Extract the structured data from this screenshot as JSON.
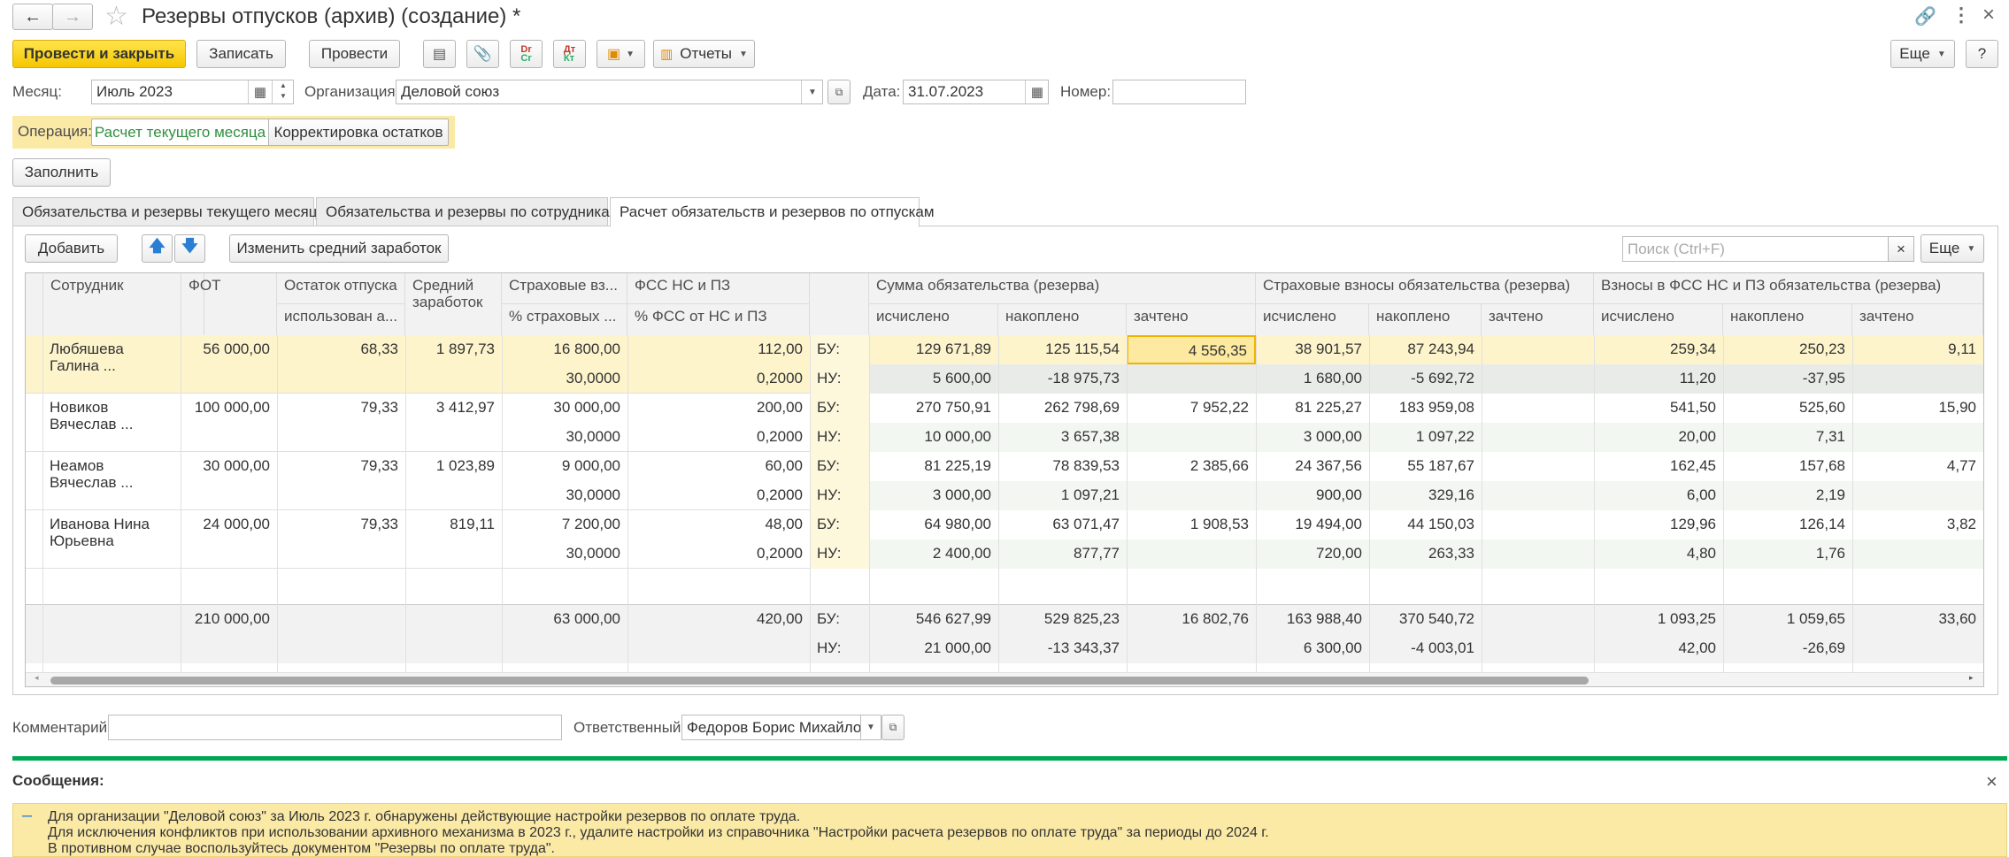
{
  "window": {
    "title": "Резервы отпусков (архив) (создание) *"
  },
  "toolbar": {
    "post_close": "Провести и закрыть",
    "save": "Записать",
    "post": "Провести",
    "reports": "Отчеты",
    "more": "Еще",
    "help": "?"
  },
  "header": {
    "month_label": "Месяц:",
    "month_value": "Июль 2023",
    "org_label": "Организация:",
    "org_value": "Деловой союз",
    "date_label": "Дата:",
    "date_value": "31.07.2023",
    "number_label": "Номер:",
    "number_value": ""
  },
  "operation": {
    "label": "Операция:",
    "options": [
      "Расчет текущего месяца",
      "Корректировка остатков"
    ],
    "selected": "Расчет текущего месяца"
  },
  "fill_button": "Заполнить",
  "tabs": [
    {
      "label": "Обязательства и резервы текущего месяца",
      "active": false
    },
    {
      "label": "Обязательства и резервы по сотрудникам",
      "active": false
    },
    {
      "label": "Расчет обязательств и резервов по отпускам",
      "active": true
    }
  ],
  "grid_toolbar": {
    "add": "Добавить",
    "change_avg": "Изменить средний заработок",
    "search_placeholder": "Поиск (Ctrl+F)",
    "clear": "×",
    "more": "Еще"
  },
  "columns": {
    "employee": "Сотрудник",
    "fot": "ФОТ",
    "vacation_balance": "Остаток отпуска",
    "vacation_used": "использован а...",
    "avg_earnings": "Средний заработок",
    "insurance": "Страховые вз...",
    "insurance_pct": "% страховых ...",
    "fss": "ФСС НС и ПЗ",
    "fss_pct": "% ФСС от НС и ПЗ",
    "group_sum": "Сумма обязательства (резерва)",
    "group_ins": "Страховые взносы обязательства (резерва)",
    "group_fss": "Взносы в ФСС НС и ПЗ обязательства (резерва)",
    "calculated": "исчислено",
    "accrued": "накоплено",
    "credited": "зачтено"
  },
  "rows": [
    {
      "employee": "Любяшева Галина ...",
      "fot": "56 000,00",
      "balance": "68,33",
      "avg": "1 897,73",
      "ins": "16 800,00",
      "ins_pct": "30,0000",
      "fss": "112,00",
      "fss_pct": "0,2000",
      "bu": [
        "129 671,89",
        "125 115,54",
        "4 556,35",
        "38 901,57",
        "87 243,94",
        "",
        "259,34",
        "250,23",
        "9,11"
      ],
      "nu": [
        "5 600,00",
        "-18 975,73",
        "",
        "1 680,00",
        "-5 692,72",
        "",
        "11,20",
        "-37,95",
        ""
      ]
    },
    {
      "employee": "Новиков Вячеслав ...",
      "fot": "100 000,00",
      "balance": "79,33",
      "avg": "3 412,97",
      "ins": "30 000,00",
      "ins_pct": "30,0000",
      "fss": "200,00",
      "fss_pct": "0,2000",
      "bu": [
        "270 750,91",
        "262 798,69",
        "7 952,22",
        "81 225,27",
        "183 959,08",
        "",
        "541,50",
        "525,60",
        "15,90"
      ],
      "nu": [
        "10 000,00",
        "3 657,38",
        "",
        "3 000,00",
        "1 097,22",
        "",
        "20,00",
        "7,31",
        ""
      ]
    },
    {
      "employee": "Неамов Вячеслав ...",
      "fot": "30 000,00",
      "balance": "79,33",
      "avg": "1 023,89",
      "ins": "9 000,00",
      "ins_pct": "30,0000",
      "fss": "60,00",
      "fss_pct": "0,2000",
      "bu": [
        "81 225,19",
        "78 839,53",
        "2 385,66",
        "24 367,56",
        "55 187,67",
        "",
        "162,45",
        "157,68",
        "4,77"
      ],
      "nu": [
        "3 000,00",
        "1 097,21",
        "",
        "900,00",
        "329,16",
        "",
        "6,00",
        "2,19",
        ""
      ]
    },
    {
      "employee": "Иванова Нина Юрьевна",
      "fot": "24 000,00",
      "balance": "79,33",
      "avg": "819,11",
      "ins": "7 200,00",
      "ins_pct": "30,0000",
      "fss": "48,00",
      "fss_pct": "0,2000",
      "bu": [
        "64 980,00",
        "63 071,47",
        "1 908,53",
        "19 494,00",
        "44 150,03",
        "",
        "129,96",
        "126,14",
        "3,82"
      ],
      "nu": [
        "2 400,00",
        "877,77",
        "",
        "720,00",
        "263,33",
        "",
        "4,80",
        "1,76",
        ""
      ]
    }
  ],
  "row_labels": {
    "bu": "БУ:",
    "nu": "НУ:"
  },
  "totals": {
    "fot": "210 000,00",
    "ins": "63 000,00",
    "fss": "420,00",
    "bu": [
      "546 627,99",
      "529 825,23",
      "16 802,76",
      "163 988,40",
      "370 540,72",
      "",
      "1 093,25",
      "1 059,65",
      "33,60"
    ],
    "nu": [
      "21 000,00",
      "-13 343,37",
      "",
      "6 300,00",
      "-4 003,01",
      "",
      "42,00",
      "-26,69",
      ""
    ]
  },
  "footer": {
    "comment_label": "Комментарий:",
    "comment_value": "",
    "responsible_label": "Ответственный:",
    "responsible_value": "Федоров Борис Михайлови"
  },
  "messages": {
    "title": "Сообщения:",
    "close": "×",
    "lines": [
      "Для организации \"Деловой союз\" за Июль 2023 г. обнаружены действующие настройки резервов по оплате труда.",
      "Для исключения конфликтов при использовании архивного механизма в 2023 г., удалите настройки из справочника \"Настройки расчета резервов по оплате труда\" за периоды до 2024 г.",
      "В противном случае воспользуйтесь документом \"Резервы по оплате труда\"."
    ]
  },
  "colors": {
    "accent_yellow": "#f5c700",
    "highlight_row": "#fdf4cc",
    "selected_cell_border": "#f0b400",
    "green_bar": "#00a651",
    "message_bg": "#fbe9a6",
    "link_green": "#2f8f3f"
  }
}
